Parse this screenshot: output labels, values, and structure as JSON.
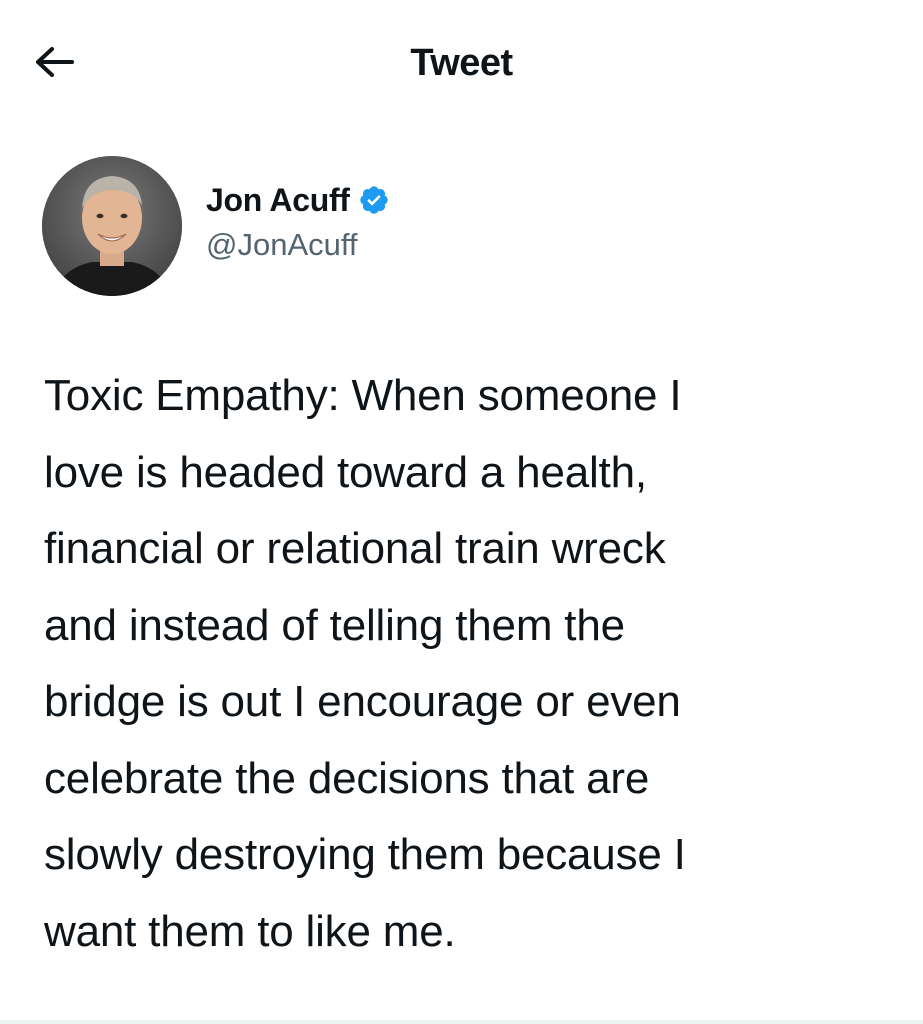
{
  "header": {
    "back_icon": "arrow-left-icon",
    "title": "Tweet"
  },
  "tweet": {
    "author": {
      "display_name": "Jon Acuff",
      "handle": "@JonAcuff",
      "verified_icon": "verified-badge-icon",
      "verified_color": "#1d9bf0"
    },
    "text": "Toxic Empathy: When someone I\nlove is headed toward a health,\nfinancial or relational train wreck\nand instead of telling them the\nbridge is out I encourage or even\ncelebrate the decisions that are\nslowly destroying them because I\nwant them to like me."
  },
  "colors": {
    "text_primary": "#0f1419",
    "text_secondary": "#536471",
    "background": "#ffffff"
  }
}
